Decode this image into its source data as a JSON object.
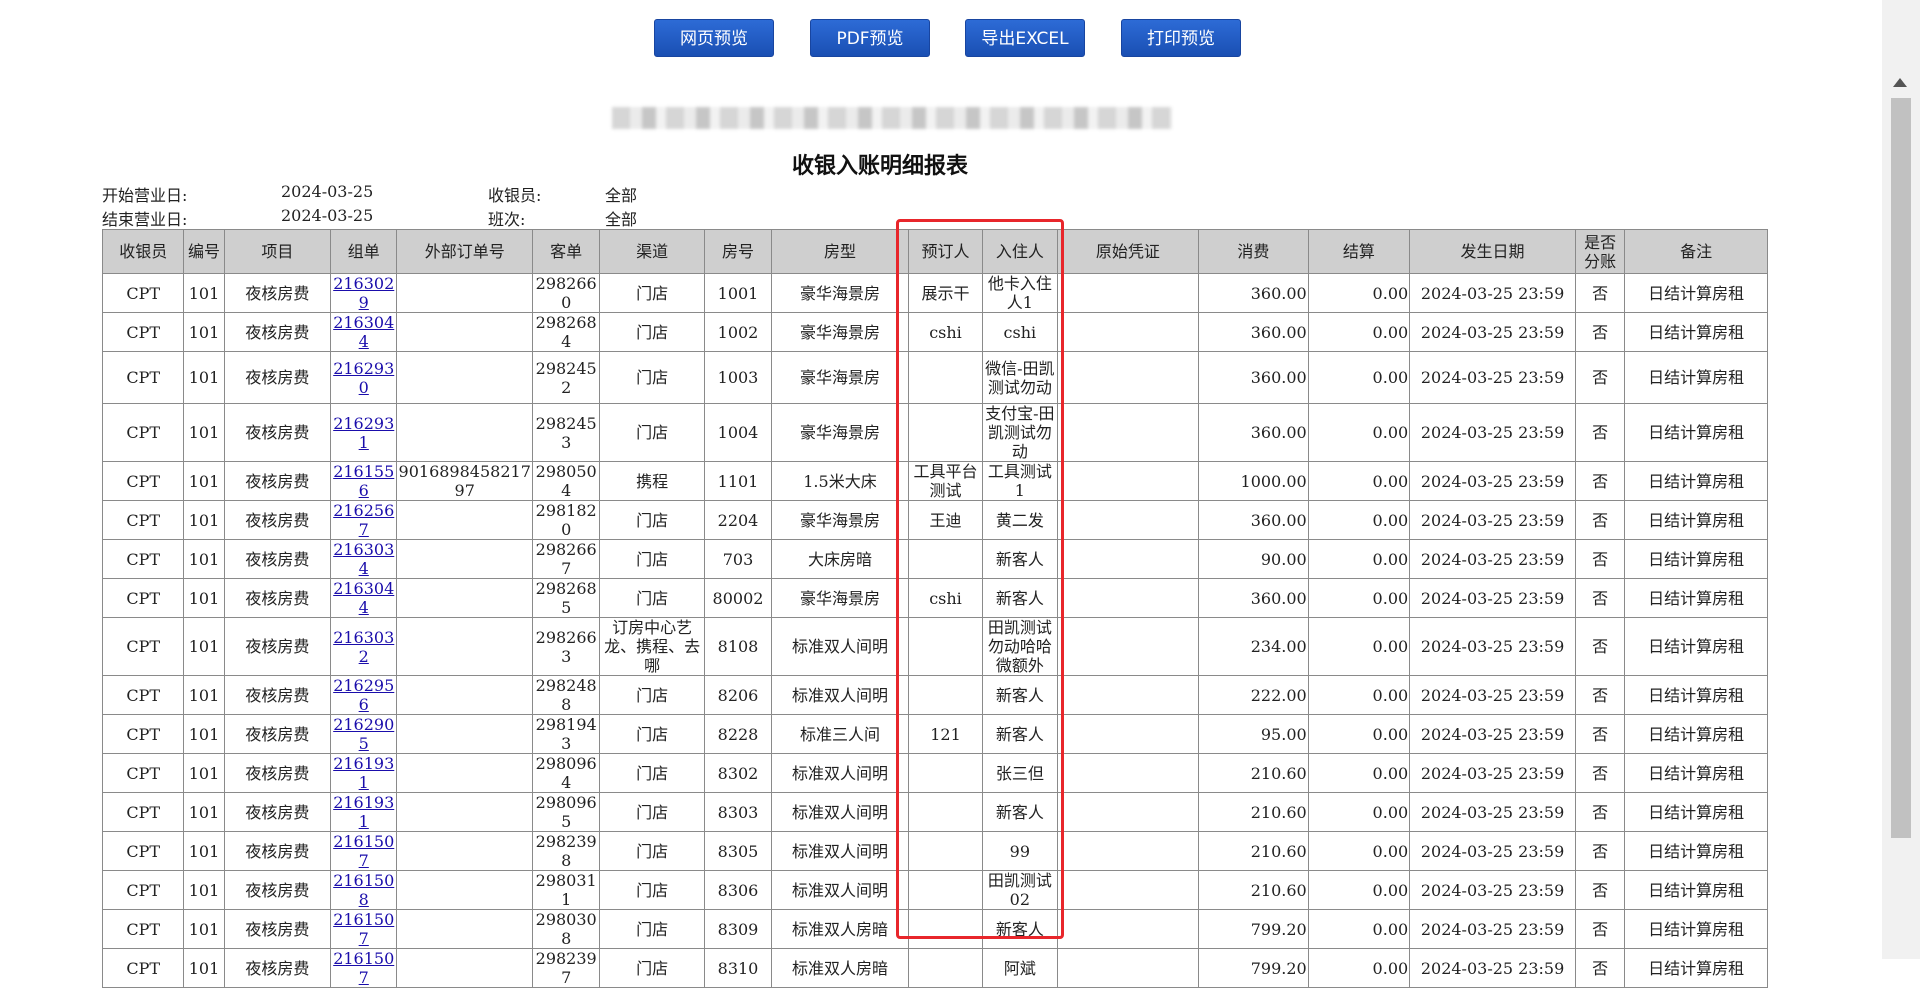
{
  "toolbar": {
    "web_preview": "网页预览",
    "pdf_preview": "PDF预览",
    "export_excel": "导出EXCEL",
    "print_preview": "打印预览"
  },
  "report": {
    "title": "收银入账明细报表",
    "start_label": "开始营业日:",
    "start_value": "2024-03-25",
    "end_label": "结束营业日:",
    "end_value": "2024-03-25",
    "cashier_label": "收银员:",
    "cashier_value": "全部",
    "shift_label": "班次:",
    "shift_value": "全部"
  },
  "columns": [
    "收银员",
    "编号",
    "项目",
    "组单",
    "外部订单号",
    "客单",
    "渠道",
    "房号",
    "房型",
    "预订人",
    "入住人",
    "原始凭证",
    "消费",
    "结算",
    "发生日期",
    "是否分账",
    "备注"
  ],
  "rows": [
    [
      "CPT",
      "101",
      "夜核房费",
      "2163029",
      "",
      "2982660",
      "门店",
      "1001",
      "豪华海景房",
      "展示干",
      "他卡入住人1",
      "",
      "360.00",
      "0.00",
      "2024-03-25 23:59",
      "否",
      "日结计算房租"
    ],
    [
      "CPT",
      "101",
      "夜核房费",
      "2163044",
      "",
      "2982684",
      "门店",
      "1002",
      "豪华海景房",
      "cshi",
      "cshi",
      "",
      "360.00",
      "0.00",
      "2024-03-25 23:59",
      "否",
      "日结计算房租"
    ],
    [
      "CPT",
      "101",
      "夜核房费",
      "2162930",
      "",
      "2982452",
      "门店",
      "1003",
      "豪华海景房",
      "",
      "微信-田凯测试勿动",
      "",
      "360.00",
      "0.00",
      "2024-03-25 23:59",
      "否",
      "日结计算房租"
    ],
    [
      "CPT",
      "101",
      "夜核房费",
      "2162931",
      "",
      "2982453",
      "门店",
      "1004",
      "豪华海景房",
      "",
      "支付宝-田凯测试勿动",
      "",
      "360.00",
      "0.00",
      "2024-03-25 23:59",
      "否",
      "日结计算房租"
    ],
    [
      "CPT",
      "101",
      "夜核房费",
      "2161556",
      "901689845821797",
      "2980504",
      "携程",
      "1101",
      "1.5米大床",
      "工具平台测试",
      "工具测试1",
      "",
      "1000.00",
      "0.00",
      "2024-03-25 23:59",
      "否",
      "日结计算房租"
    ],
    [
      "CPT",
      "101",
      "夜核房费",
      "2162567",
      "",
      "2981820",
      "门店",
      "2204",
      "豪华海景房",
      "王迪",
      "黄二发",
      "",
      "360.00",
      "0.00",
      "2024-03-25 23:59",
      "否",
      "日结计算房租"
    ],
    [
      "CPT",
      "101",
      "夜核房费",
      "2163034",
      "",
      "2982667",
      "门店",
      "703",
      "大床房暗",
      "",
      "新客人",
      "",
      "90.00",
      "0.00",
      "2024-03-25 23:59",
      "否",
      "日结计算房租"
    ],
    [
      "CPT",
      "101",
      "夜核房费",
      "2163044",
      "",
      "2982685",
      "门店",
      "80002",
      "豪华海景房",
      "cshi",
      "新客人",
      "",
      "360.00",
      "0.00",
      "2024-03-25 23:59",
      "否",
      "日结计算房租"
    ],
    [
      "CPT",
      "101",
      "夜核房费",
      "2163032",
      "",
      "2982663",
      "订房中心艺龙、携程、去哪",
      "8108",
      "标准双人间明",
      "",
      "田凯测试勿动哈哈微额外",
      "",
      "234.00",
      "0.00",
      "2024-03-25 23:59",
      "否",
      "日结计算房租"
    ],
    [
      "CPT",
      "101",
      "夜核房费",
      "2162956",
      "",
      "2982488",
      "门店",
      "8206",
      "标准双人间明",
      "",
      "新客人",
      "",
      "222.00",
      "0.00",
      "2024-03-25 23:59",
      "否",
      "日结计算房租"
    ],
    [
      "CPT",
      "101",
      "夜核房费",
      "2162905",
      "",
      "2981943",
      "门店",
      "8228",
      "标准三人间",
      "121",
      "新客人",
      "",
      "95.00",
      "0.00",
      "2024-03-25 23:59",
      "否",
      "日结计算房租"
    ],
    [
      "CPT",
      "101",
      "夜核房费",
      "2161931",
      "",
      "2980964",
      "门店",
      "8302",
      "标准双人间明",
      "",
      "张三但",
      "",
      "210.60",
      "0.00",
      "2024-03-25 23:59",
      "否",
      "日结计算房租"
    ],
    [
      "CPT",
      "101",
      "夜核房费",
      "2161931",
      "",
      "2980965",
      "门店",
      "8303",
      "标准双人间明",
      "",
      "新客人",
      "",
      "210.60",
      "0.00",
      "2024-03-25 23:59",
      "否",
      "日结计算房租"
    ],
    [
      "CPT",
      "101",
      "夜核房费",
      "2161507",
      "",
      "2982398",
      "门店",
      "8305",
      "标准双人间明",
      "",
      "99",
      "",
      "210.60",
      "0.00",
      "2024-03-25 23:59",
      "否",
      "日结计算房租"
    ],
    [
      "CPT",
      "101",
      "夜核房费",
      "2161508",
      "",
      "2980311",
      "门店",
      "8306",
      "标准双人间明",
      "",
      "田凯测试02",
      "",
      "210.60",
      "0.00",
      "2024-03-25 23:59",
      "否",
      "日结计算房租"
    ],
    [
      "CPT",
      "101",
      "夜核房费",
      "2161507",
      "",
      "2980308",
      "门店",
      "8309",
      "标准双人房暗",
      "",
      "新客人",
      "",
      "799.20",
      "0.00",
      "2024-03-25 23:59",
      "否",
      "日结计算房租"
    ],
    [
      "CPT",
      "101",
      "夜核房费",
      "2161507",
      "",
      "2982397",
      "门店",
      "8310",
      "标准双人房暗",
      "",
      "阿斌",
      "",
      "799.20",
      "0.00",
      "2024-03-25 23:59",
      "否",
      "日结计算房租"
    ]
  ]
}
